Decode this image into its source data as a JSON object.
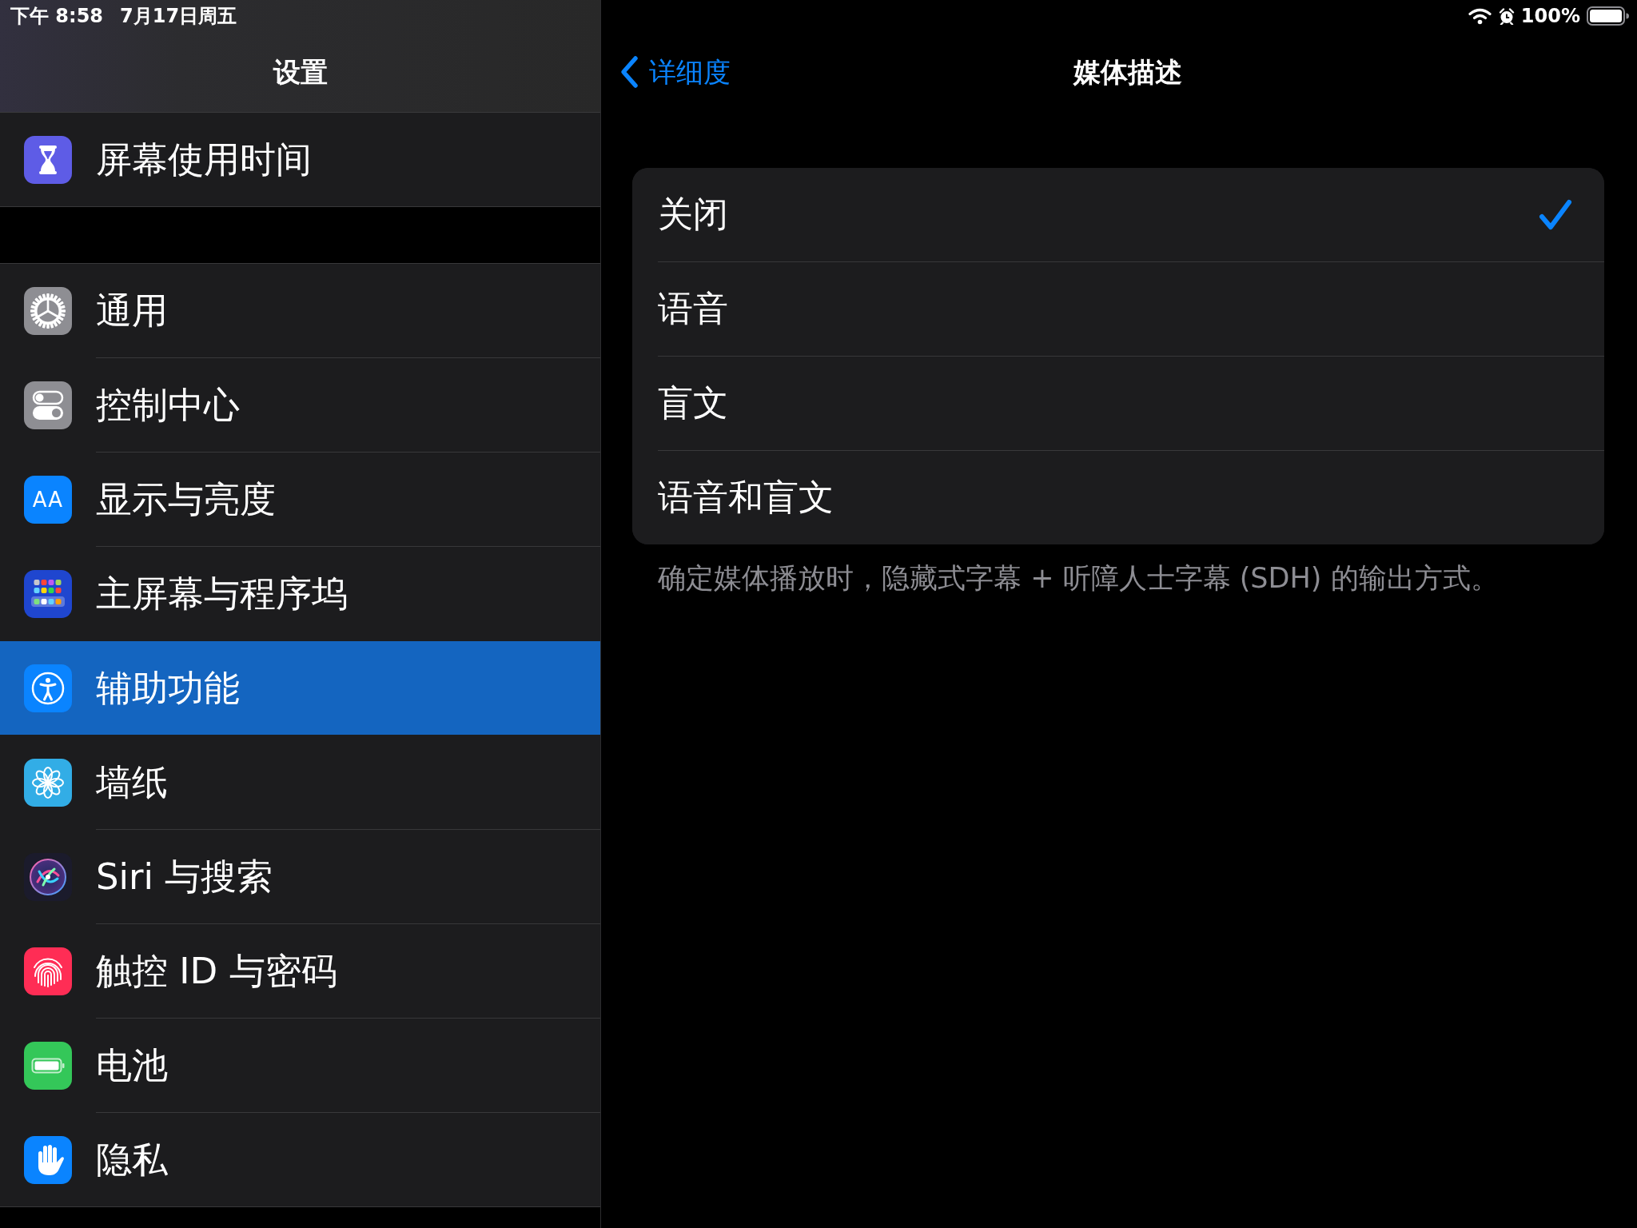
{
  "status_bar": {
    "time": "下午 8:58",
    "date": "7月17日周五",
    "battery": "100%"
  },
  "sidebar": {
    "title": "设置",
    "groups": [
      {
        "items": [
          {
            "label": "屏幕使用时间",
            "selected": false
          }
        ]
      },
      {
        "items": [
          {
            "label": "通用",
            "selected": false
          },
          {
            "label": "控制中心",
            "selected": false
          },
          {
            "label": "显示与亮度",
            "selected": false,
            "icon_text": "AA"
          },
          {
            "label": "主屏幕与程序坞",
            "selected": false
          },
          {
            "label": "辅助功能",
            "selected": true
          },
          {
            "label": "墙纸",
            "selected": false
          },
          {
            "label": "Siri 与搜索",
            "selected": false
          },
          {
            "label": "触控 ID 与密码",
            "selected": false
          },
          {
            "label": "电池",
            "selected": false
          },
          {
            "label": "隐私",
            "selected": false
          }
        ]
      }
    ]
  },
  "detail": {
    "back": "详细度",
    "title": "媒体描述",
    "options": [
      {
        "label": "关闭",
        "selected": true
      },
      {
        "label": "语音",
        "selected": false
      },
      {
        "label": "盲文",
        "selected": false
      },
      {
        "label": "语音和盲文",
        "selected": false
      }
    ],
    "footer": "确定媒体播放时，隐藏式字幕 + 听障人士字幕 (SDH) 的输出方式。"
  }
}
